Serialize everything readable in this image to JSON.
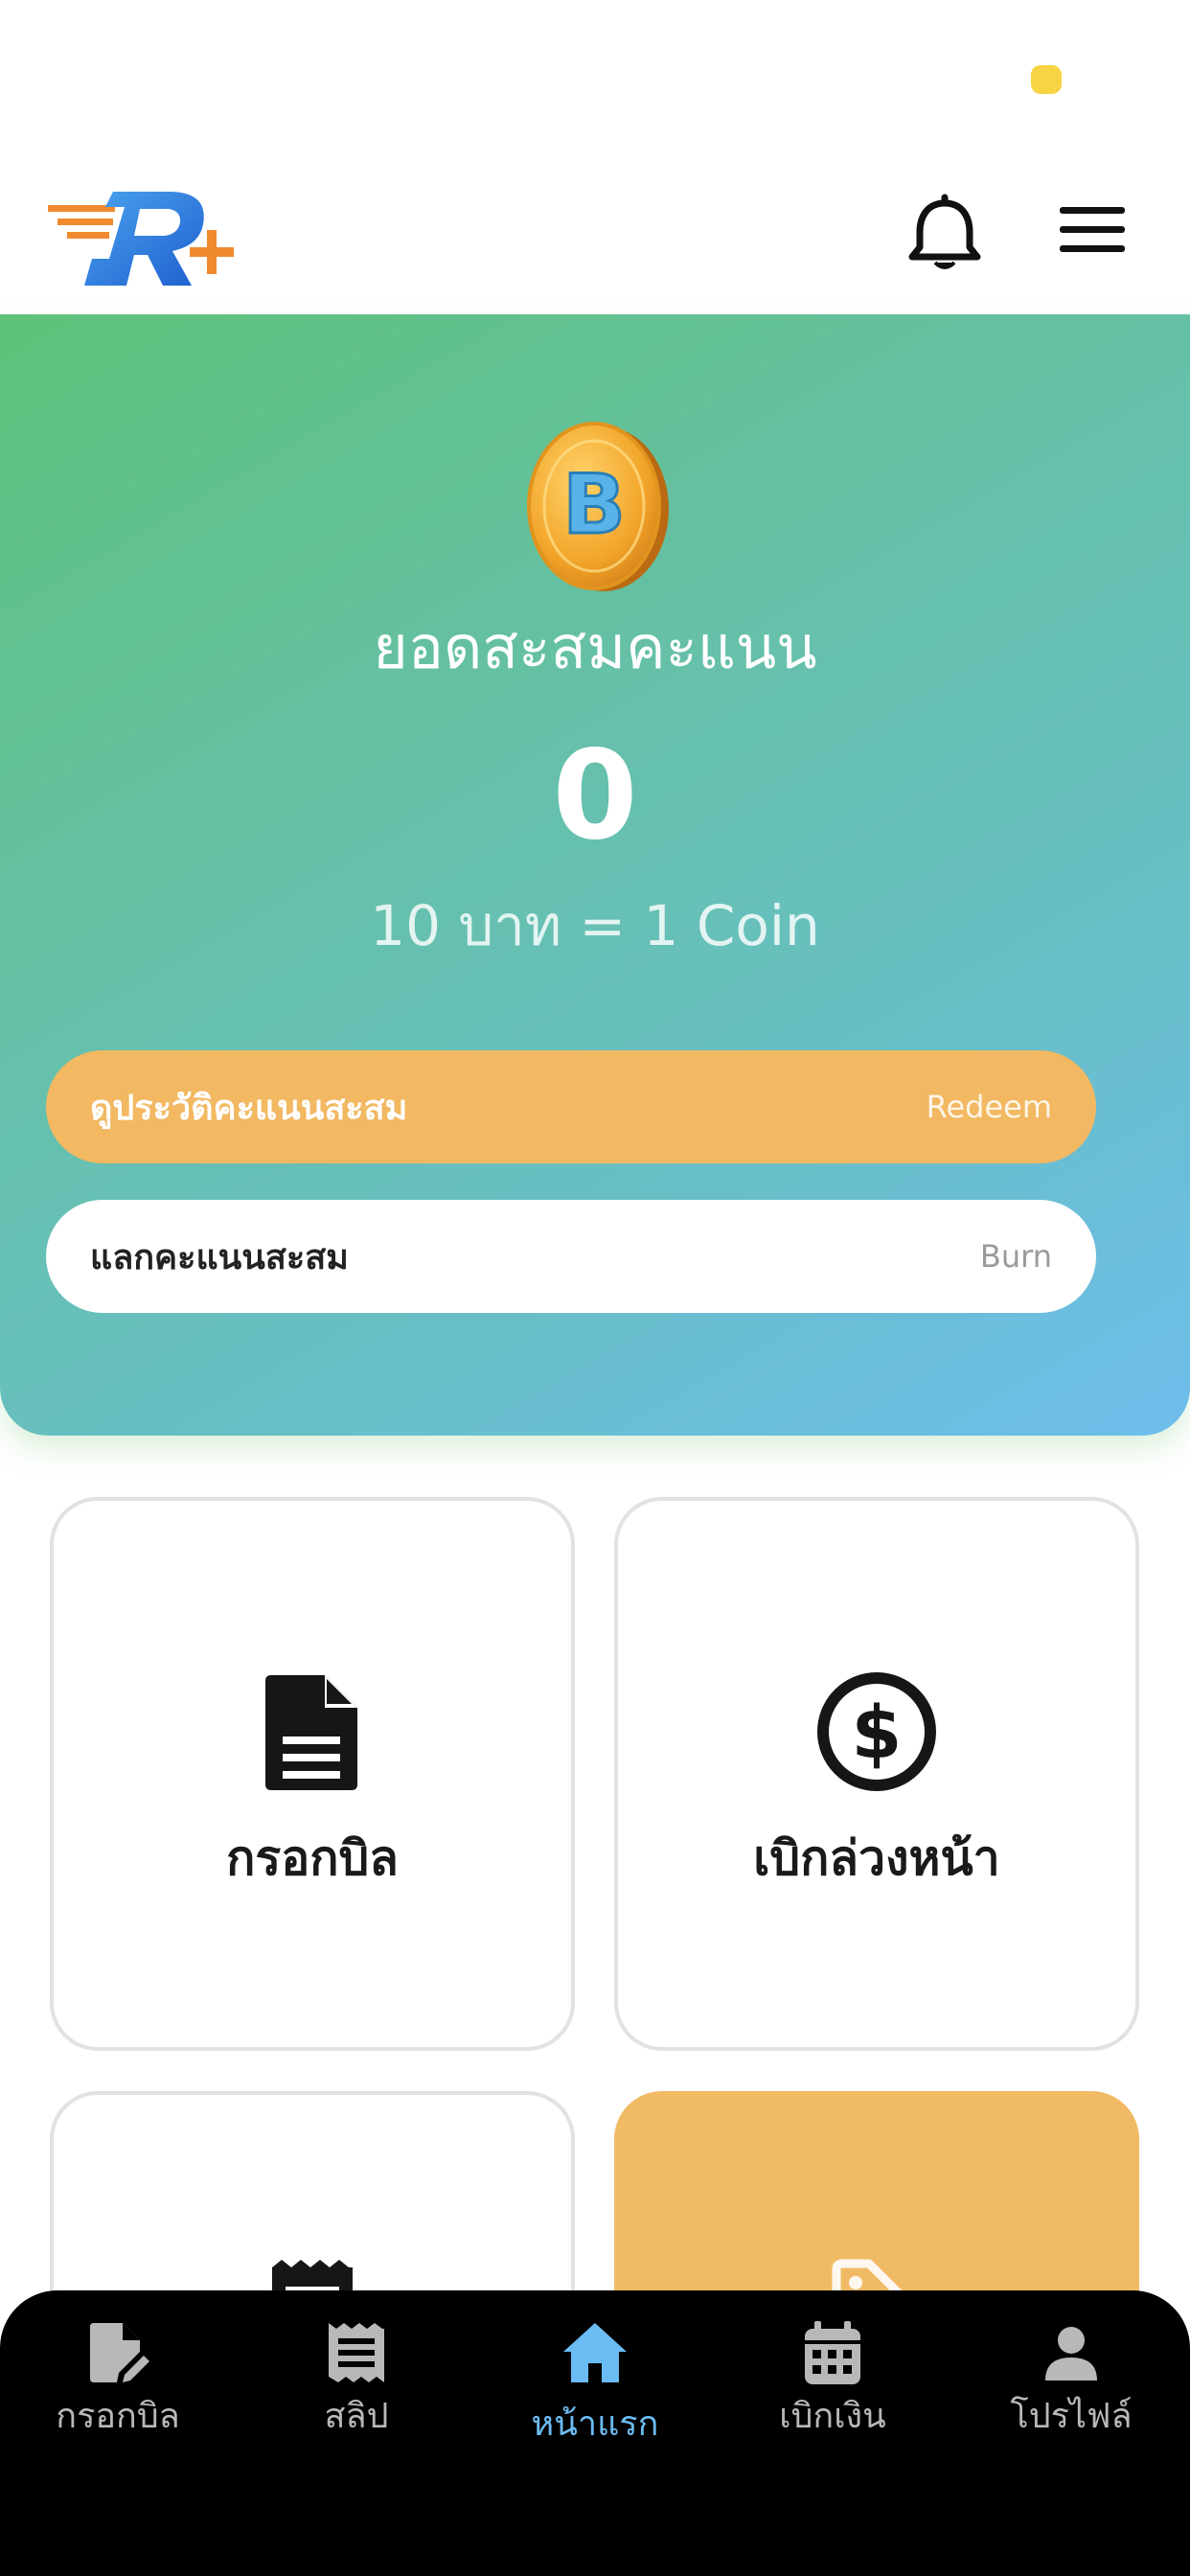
{
  "hero": {
    "title": "ยอดสะสมคะแนน",
    "points": "0",
    "rate": "10 บาท = 1 Coin",
    "history_button": {
      "label": "ดูประวัติคะแนนสะสม",
      "tag": "Redeem"
    },
    "burn_button": {
      "label": "แลกคะแนนสะสม",
      "tag": "Burn"
    }
  },
  "tiles": [
    {
      "label": "กรอกบิล",
      "icon": "document-icon"
    },
    {
      "label": "เบิกล่วงหน้า",
      "icon": "dollar-circle-icon"
    },
    {
      "label": "",
      "icon": "receipt-icon"
    },
    {
      "label": "",
      "icon": "tag-icon"
    }
  ],
  "tabbar": {
    "items": [
      {
        "label": "กรอกบิล",
        "icon": "edit-document-icon",
        "active": false
      },
      {
        "label": "สลิป",
        "icon": "receipt-icon",
        "active": false
      },
      {
        "label": "หน้าแรก",
        "icon": "home-icon",
        "active": true
      },
      {
        "label": "เบิกเงิน",
        "icon": "calendar-icon",
        "active": false
      },
      {
        "label": "โปรไฟล์",
        "icon": "person-icon",
        "active": false
      }
    ]
  },
  "colors": {
    "hero_gradient_start": "#5ec27a",
    "hero_gradient_end": "#6ebdec",
    "accent_orange": "#f2b862",
    "tab_active": "#6cbcf4",
    "tab_inactive": "#b8b8b8",
    "status_dot": "#f7d443"
  }
}
